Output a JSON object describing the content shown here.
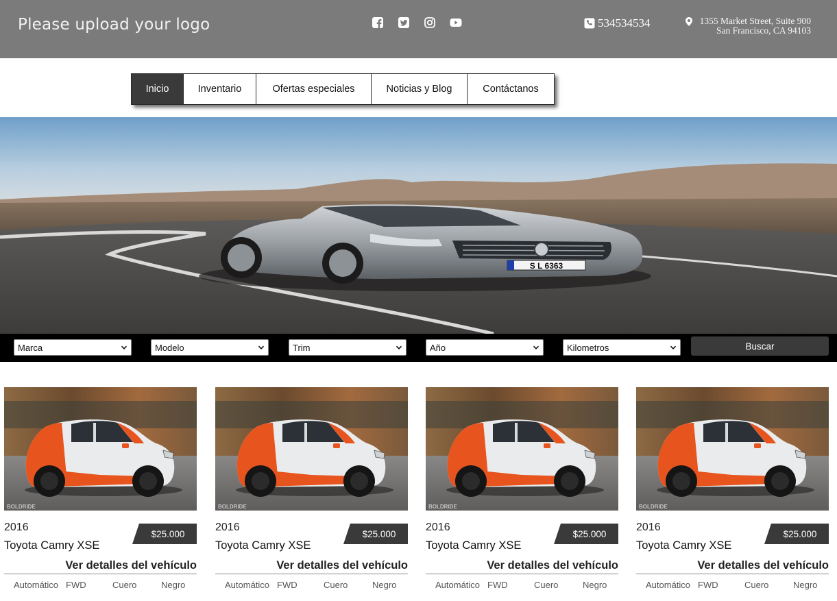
{
  "header": {
    "logo_text": "Please upload your logo",
    "social_icons": [
      "facebook-icon",
      "twitter-icon",
      "instagram-icon",
      "youtube-icon"
    ],
    "phone": "534534534",
    "address_line1": "1355 Market Street, Suite 900",
    "address_line2": "San Francisco, CA 94103"
  },
  "nav": {
    "items": [
      "Inicio",
      "Inventario",
      "Ofertas especiales",
      "Noticias y Blog",
      "Contáctanos"
    ],
    "active": "Inicio"
  },
  "hero": {
    "plate_text": "S L 6363"
  },
  "search": {
    "make": "Marca",
    "model": "Modelo",
    "trim": "Trim",
    "year": "Año",
    "mileage": "Kilometros",
    "button": "Buscar"
  },
  "listings": [
    {
      "year": "2016",
      "title": "Toyota Camry XSE",
      "price": "$25.000",
      "details": "Ver detalles del vehículo",
      "transmission": "Automático",
      "drive": "FWD",
      "interior": "Cuero",
      "color": "Negro",
      "watermark": "BOLDRIDE"
    },
    {
      "year": "2016",
      "title": "Toyota Camry XSE",
      "price": "$25.000",
      "details": "Ver detalles del vehículo",
      "transmission": "Automático",
      "drive": "FWD",
      "interior": "Cuero",
      "color": "Negro",
      "watermark": "BOLDRIDE"
    },
    {
      "year": "2016",
      "title": "Toyota Camry XSE",
      "price": "$25.000",
      "details": "Ver detalles del vehículo",
      "transmission": "Automático",
      "drive": "FWD",
      "interior": "Cuero",
      "color": "Negro",
      "watermark": "BOLDRIDE"
    },
    {
      "year": "2016",
      "title": "Toyota Camry XSE",
      "price": "$25.000",
      "details": "Ver detalles del vehículo",
      "transmission": "Automático",
      "drive": "FWD",
      "interior": "Cuero",
      "color": "Negro",
      "watermark": "BOLDRIDE"
    }
  ],
  "colors": {
    "header_bg": "#7b7b7b",
    "nav_active_bg": "#3a3a3a",
    "search_bar_bg": "#000000",
    "price_tag_bg": "#3a3a3a",
    "car_accent": "#e8541e"
  }
}
